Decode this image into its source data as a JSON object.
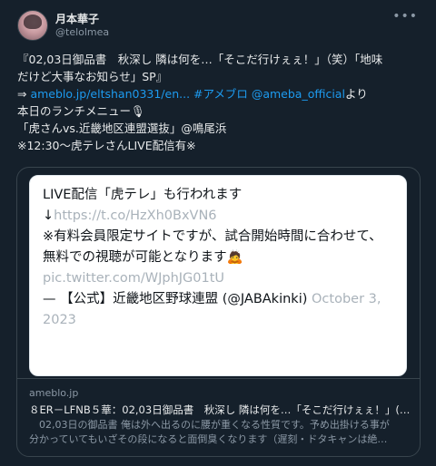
{
  "author": {
    "name": "月本華子",
    "handle": "@telolmea"
  },
  "menu_icon": "•••",
  "tweet": {
    "line1": "『02,03日御品書　秋深し 隣は何を…「そこだ行けぇぇ！」（笑）「地味",
    "line2": "だけど大事なお知らせ」SP』",
    "line3_prefix": "⇒ ",
    "line3_link1": "ameblo.jp/eltshan0331/en...",
    "line3_hashtag": " #アメブロ ",
    "line3_mention": "@ameba_official",
    "line3_suffix": "より",
    "line4": "本日のランチメニュー🎙",
    "line5": "「虎さんvs.近畿地区連盟選抜」@鳴尾浜",
    "line6": "※12:30〜虎テレさんLIVE配信有※"
  },
  "embed": {
    "line1": "LIVE配信「虎テレ」も行われます",
    "line2_prefix": "↓",
    "line2_link": "https://t.co/HzXh0BxVN6",
    "line3": "※有料会員限定サイトですが、試合開始時間に合わせて、",
    "line4": "無料での視聴が可能となります🙇",
    "line5": "pic.twitter.com/WJphJG01tU",
    "line6_prefix": "— 【公式】近畿地区野球連盟 (@JABAkinki) ",
    "line6_date": "October 3,",
    "line7_date": "2023"
  },
  "card": {
    "domain": "ameblo.jp",
    "title": "８ER－LFNB５華：02,03日御品書　秋深し 隣は何を…「そこだ行けぇぇ！」(…",
    "desc_line1": "　02,03日の御品書 俺は外へ出るのに腰が重くなる性質です。予め出掛ける事が",
    "desc_line2": "分かっていてもいざその段になると面倒臭くなります（遅刻・ドタキャンは絶…"
  }
}
